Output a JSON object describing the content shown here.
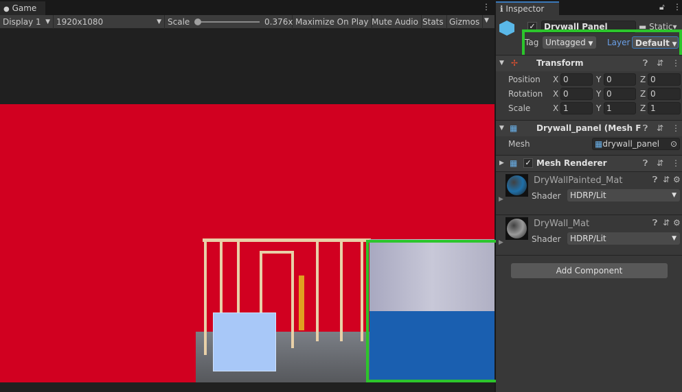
{
  "game": {
    "tab_label": "Game",
    "display": "Display 1",
    "resolution": "1920x1080",
    "scale_label": "Scale",
    "scale_value": "0.376x",
    "scale_fraction": 0.0,
    "maximize": "Maximize On Play",
    "mute": "Mute Audio",
    "stats": "Stats",
    "gizmos": "Gizmos"
  },
  "inspector": {
    "tab_label": "Inspector",
    "object_name": "Drywall Panel",
    "static_label": "Static",
    "tag_label": "Tag",
    "tag_value": "Untagged",
    "layer_label": "Layer",
    "layer_value": "Default",
    "transform": {
      "title": "Transform",
      "rows": [
        {
          "label": "Position",
          "x": "0",
          "y": "0",
          "z": "0"
        },
        {
          "label": "Rotation",
          "x": "0",
          "y": "0",
          "z": "0"
        },
        {
          "label": "Scale",
          "x": "1",
          "y": "1",
          "z": "1"
        }
      ]
    },
    "mesh_filter": {
      "title": "Drywall_panel (Mesh Filte",
      "mesh_label": "Mesh",
      "mesh_value": "drywall_panel"
    },
    "mesh_renderer": {
      "title": "Mesh Renderer"
    },
    "materials": [
      {
        "name": "DryWallPainted_Mat",
        "shader_label": "Shader",
        "shader": "HDRP/Lit",
        "color": "#1f6fa8"
      },
      {
        "name": "DryWall_Mat",
        "shader_label": "Shader",
        "shader": "HDRP/Lit",
        "color": "#9a9a9a"
      }
    ],
    "add_component": "Add Component"
  },
  "colors": {
    "highlight": "#2cc52c",
    "background_red": "#d10020"
  }
}
